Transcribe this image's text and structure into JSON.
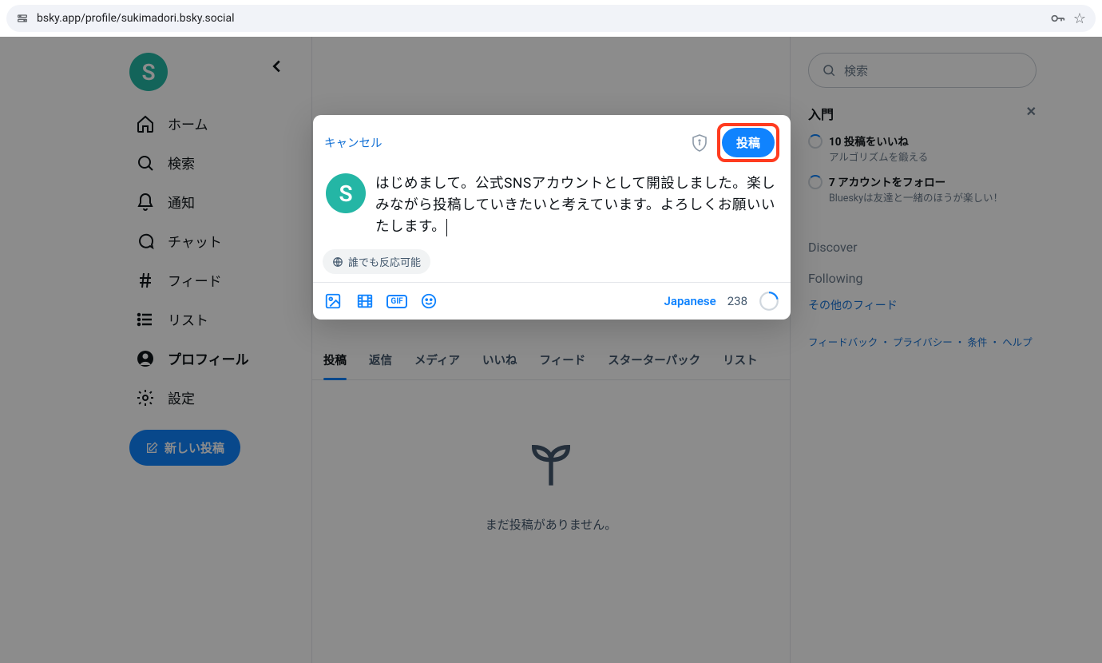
{
  "url": "bsky.app/profile/sukimadori.bsky.social",
  "sidebar": {
    "avatar_letter": "S",
    "items": [
      {
        "label": "ホーム"
      },
      {
        "label": "検索"
      },
      {
        "label": "通知"
      },
      {
        "label": "チャット"
      },
      {
        "label": "フィード"
      },
      {
        "label": "リスト"
      },
      {
        "label": "プロフィール"
      },
      {
        "label": "設定"
      }
    ],
    "new_post": "新しい投稿"
  },
  "compose": {
    "cancel": "キャンセル",
    "post": "投稿",
    "text": "はじめまして。公式SNSアカウントとして開設しました。楽しみながら投稿していきたいと考えています。よろしくお願いいたします。",
    "interaction": "誰でも反応可能",
    "language": "Japanese",
    "char_count": "238"
  },
  "profile_tabs": [
    "投稿",
    "返信",
    "メディア",
    "いいね",
    "フィード",
    "スターターパック",
    "リスト"
  ],
  "empty_message": "まだ投稿がありません。",
  "right": {
    "search_placeholder": "検索",
    "onboarding_title": "入門",
    "tasks": [
      {
        "title": "10 投稿をいいね",
        "sub": "アルゴリズムを鍛える"
      },
      {
        "title": "7 アカウントをフォロー",
        "sub": "Blueskyは友達と一緒のほうが楽しい！"
      }
    ],
    "feeds": [
      "Discover",
      "Following"
    ],
    "more_feeds": "その他のフィード",
    "footer": "フィードバック ・ プライバシー ・ 条件 ・ ヘルプ"
  }
}
